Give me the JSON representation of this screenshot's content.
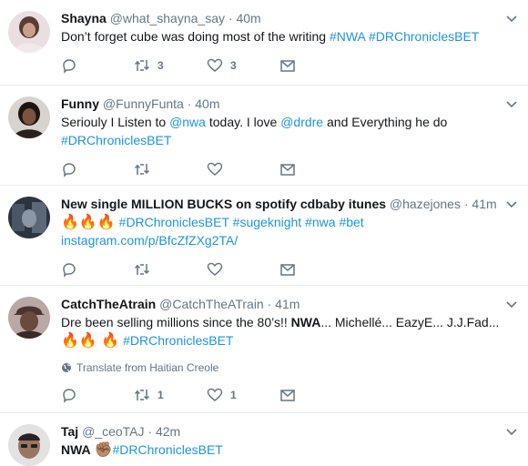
{
  "tweets": [
    {
      "name": "Shayna",
      "handle": "@what_shayna_say",
      "dot": "·",
      "time": "40m",
      "parts": [
        {
          "t": "Don’t forget cube was doing most of the writing ",
          "k": "text"
        },
        {
          "t": "#NWA",
          "k": "link"
        },
        {
          "t": " ",
          "k": "text"
        },
        {
          "t": "#DRChroniclesBET",
          "k": "link"
        }
      ],
      "reply_count": "",
      "retweet_count": "3",
      "like_count": "3"
    },
    {
      "name": "Funny",
      "handle": "@FunnyFunta",
      "dot": "·",
      "time": "40m",
      "parts": [
        {
          "t": "Seriouly I Listen to ",
          "k": "text"
        },
        {
          "t": "@nwa",
          "k": "link"
        },
        {
          "t": " today. I love ",
          "k": "text"
        },
        {
          "t": "@drdre",
          "k": "link"
        },
        {
          "t": " and Everything he do ",
          "k": "text"
        },
        {
          "t": "#DRChroniclesBET",
          "k": "link"
        }
      ],
      "reply_count": "",
      "retweet_count": "",
      "like_count": ""
    },
    {
      "name": "New single MILLION BUCKS on spotify cdbaby itunes",
      "handle": "@hazejones",
      "dot": "·",
      "time": "41m",
      "parts": [
        {
          "t": "🔥🔥🔥",
          "k": "emoji"
        },
        {
          "t": " ",
          "k": "text"
        },
        {
          "t": "#DRChroniclesBET",
          "k": "link"
        },
        {
          "t": " ",
          "k": "text"
        },
        {
          "t": "#sugeknight",
          "k": "link"
        },
        {
          "t": " ",
          "k": "text"
        },
        {
          "t": "#nwa",
          "k": "link"
        },
        {
          "t": " ",
          "k": "text"
        },
        {
          "t": "#bet",
          "k": "link"
        },
        {
          "t": " ",
          "k": "text"
        },
        {
          "t": "instagram.com/p/BfcZfZXg2TA/",
          "k": "link"
        }
      ],
      "reply_count": "",
      "retweet_count": "",
      "like_count": ""
    },
    {
      "name": "CatchTheAtrain",
      "handle": "@CatchTheATrain",
      "dot": "·",
      "time": "41m",
      "parts": [
        {
          "t": "Dre been selling millions since the 80’s!! ",
          "k": "text"
        },
        {
          "t": "NWA",
          "k": "strong"
        },
        {
          "t": "... Michellé... EazyE... J.J.Fad... ",
          "k": "text"
        },
        {
          "t": "🔥🔥 🔥",
          "k": "emoji"
        },
        {
          "t": " ",
          "k": "text"
        },
        {
          "t": "#DRChroniclesBET",
          "k": "link"
        }
      ],
      "translate": "Translate from Haitian Creole",
      "reply_count": "",
      "retweet_count": "1",
      "like_count": "1"
    },
    {
      "name": "Taj",
      "handle": "@_ceoTAJ",
      "dot": "·",
      "time": "42m",
      "parts": [
        {
          "t": "NWA",
          "k": "strong"
        },
        {
          "t": " ",
          "k": "text"
        },
        {
          "t": "✊🏽",
          "k": "emoji"
        },
        {
          "t": "#DRChroniclesBET",
          "k": "link"
        }
      ],
      "reply_count": "",
      "retweet_count": "",
      "like_count": ""
    }
  ],
  "icons": {
    "reply": "reply-icon",
    "retweet": "retweet-icon",
    "like": "heart-icon",
    "dm": "envelope-icon",
    "caret": "chevron-down-icon",
    "globe": "globe-icon"
  },
  "colors": {
    "link": "#1b95e0",
    "secondary": "#657786",
    "text": "#14171a",
    "divider": "#e6ecf0"
  }
}
